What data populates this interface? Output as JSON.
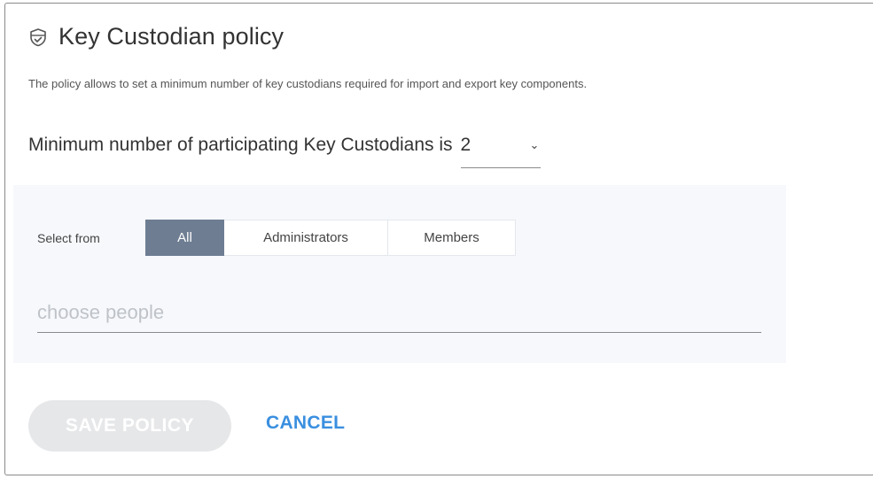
{
  "header": {
    "title": "Key Custodian policy",
    "icon": "shield-check-icon"
  },
  "description": "The policy allows to set a minimum number of key custodians required for import and export key components.",
  "minimum": {
    "label": "Minimum number of participating Key Custodians is",
    "value": "2"
  },
  "selector": {
    "label": "Select from",
    "options": [
      {
        "label": "All",
        "active": true
      },
      {
        "label": "Administrators",
        "active": false
      },
      {
        "label": "Members",
        "active": false
      }
    ],
    "people_placeholder": "choose people"
  },
  "actions": {
    "save_label": "SAVE POLICY",
    "cancel_label": "CANCEL"
  },
  "colors": {
    "accent": "#3a8fe0",
    "active_segment": "#6e7d92",
    "disabled_button": "#e6e7e9"
  }
}
